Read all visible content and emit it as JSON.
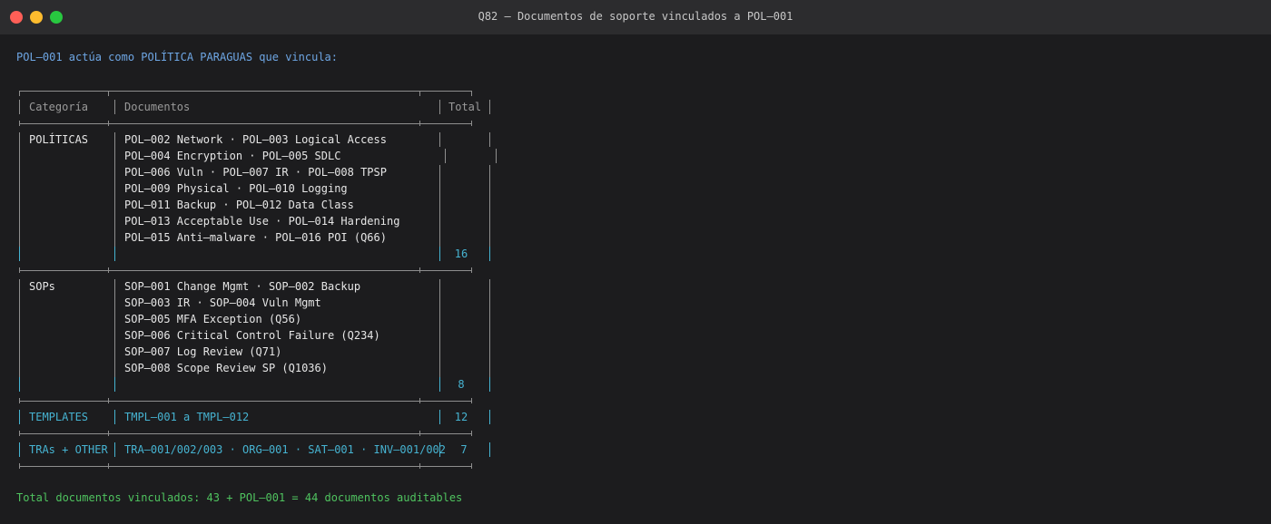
{
  "window": {
    "title": "Q82 — Documentos de soporte vinculados a POL–001"
  },
  "terminal": {
    "intro": "POL–001 actúa como POLÍTICA PARAGUAS que vincula:",
    "table": {
      "headers": {
        "category": "Categoría",
        "documents": "Documentos",
        "total": "Total"
      },
      "politicas": {
        "category": "POLÍTICAS",
        "docs": [
          "POL–002 Network · POL–003 Logical Access",
          "POL–004 Encryption · POL–005 SDLC",
          "POL–006 Vuln · POL–007 IR · POL–008 TPSP",
          "POL–009 Physical · POL–010 Logging",
          "POL–011 Backup · POL–012 Data Class",
          "POL–013 Acceptable Use · POL–014 Hardening",
          "POL–015 Anti–malware · POL–016 POI (Q66)"
        ],
        "total": "16"
      },
      "sops": {
        "category": "SOPs",
        "docs": [
          "SOP–001 Change Mgmt · SOP–002 Backup",
          "SOP–003 IR · SOP–004 Vuln Mgmt",
          "SOP–005 MFA Exception (Q56)",
          "SOP–006 Critical Control Failure (Q234)",
          "SOP–007 Log Review (Q71)",
          "SOP–008 Scope Review SP (Q1036)"
        ],
        "total": "8"
      },
      "templates": {
        "category": "TEMPLATES",
        "docs": "TMPL–001 a TMPL–012",
        "total": "12"
      },
      "tras": {
        "category": "TRAs + OTHER",
        "docs": "TRA–001/002/003 · ORG–001 · SAT–001 · INV–001/002",
        "total": "7"
      }
    },
    "footer": "Total documentos vinculados: 43 + POL–001 = 44 documentos auditables"
  },
  "colors": {
    "background": "#1c1c1e",
    "titlebar": "#2c2c2e",
    "intro_blue": "#6ea6e4",
    "cyan": "#46b3d1",
    "footer_green": "#4fc35f",
    "border_gray": "#8e8e8e"
  }
}
